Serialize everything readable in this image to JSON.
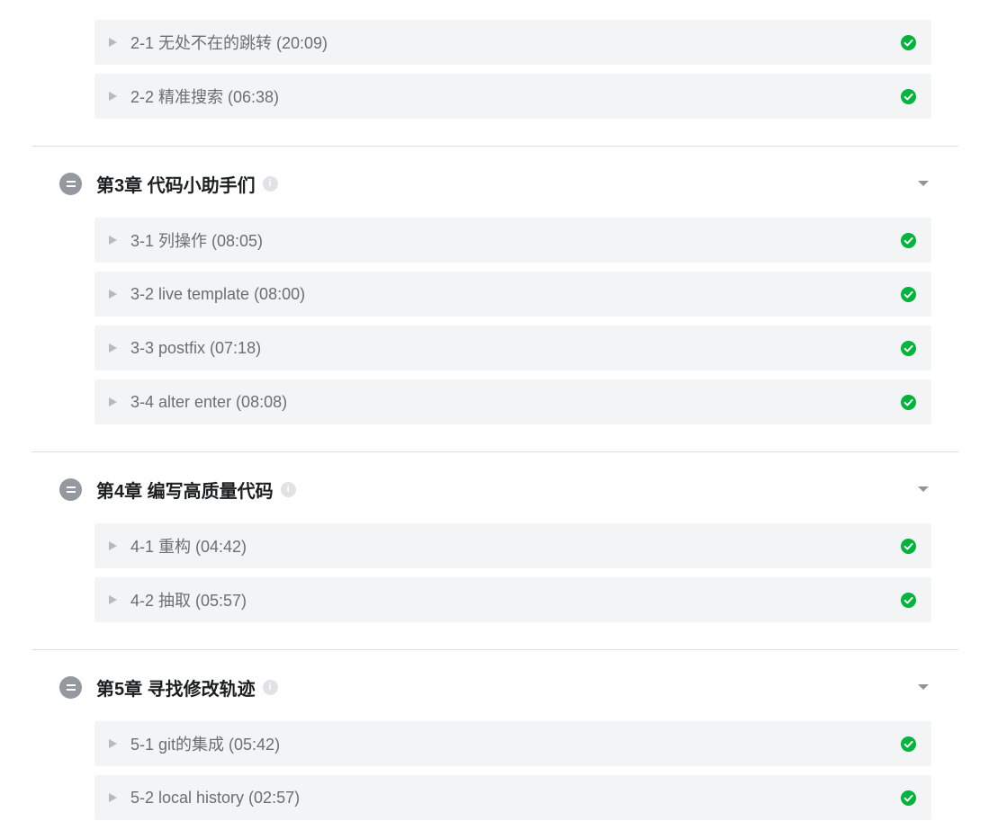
{
  "sections": [
    {
      "lessons": [
        {
          "title": "2-1 无处不在的跳转 (20:09)",
          "completed": true
        },
        {
          "title": "2-2 精准搜索 (06:38)",
          "completed": true
        }
      ]
    },
    {
      "title": "第3章 代码小助手们",
      "info_icon": "info-icon",
      "lessons": [
        {
          "title": "3-1 列操作 (08:05)",
          "completed": true
        },
        {
          "title": "3-2 live template (08:00)",
          "completed": true
        },
        {
          "title": "3-3 postfix (07:18)",
          "completed": true
        },
        {
          "title": "3-4 alter enter (08:08)",
          "completed": true
        }
      ]
    },
    {
      "title": "第4章 编写高质量代码",
      "info_icon": "info-icon",
      "lessons": [
        {
          "title": "4-1 重构 (04:42)",
          "completed": true
        },
        {
          "title": "4-2 抽取 (05:57)",
          "completed": true
        }
      ]
    },
    {
      "title": "第5章 寻找修改轨迹",
      "info_icon": "info-icon",
      "lessons": [
        {
          "title": "5-1 git的集成 (05:42)",
          "completed": true
        },
        {
          "title": "5-2 local history (02:57)",
          "completed": true
        }
      ]
    }
  ],
  "colors": {
    "lesson_bg": "#f3f4f6",
    "complete_green": "#00b43c",
    "chapter_badge": "#93999f",
    "divider": "#dcdee0"
  }
}
